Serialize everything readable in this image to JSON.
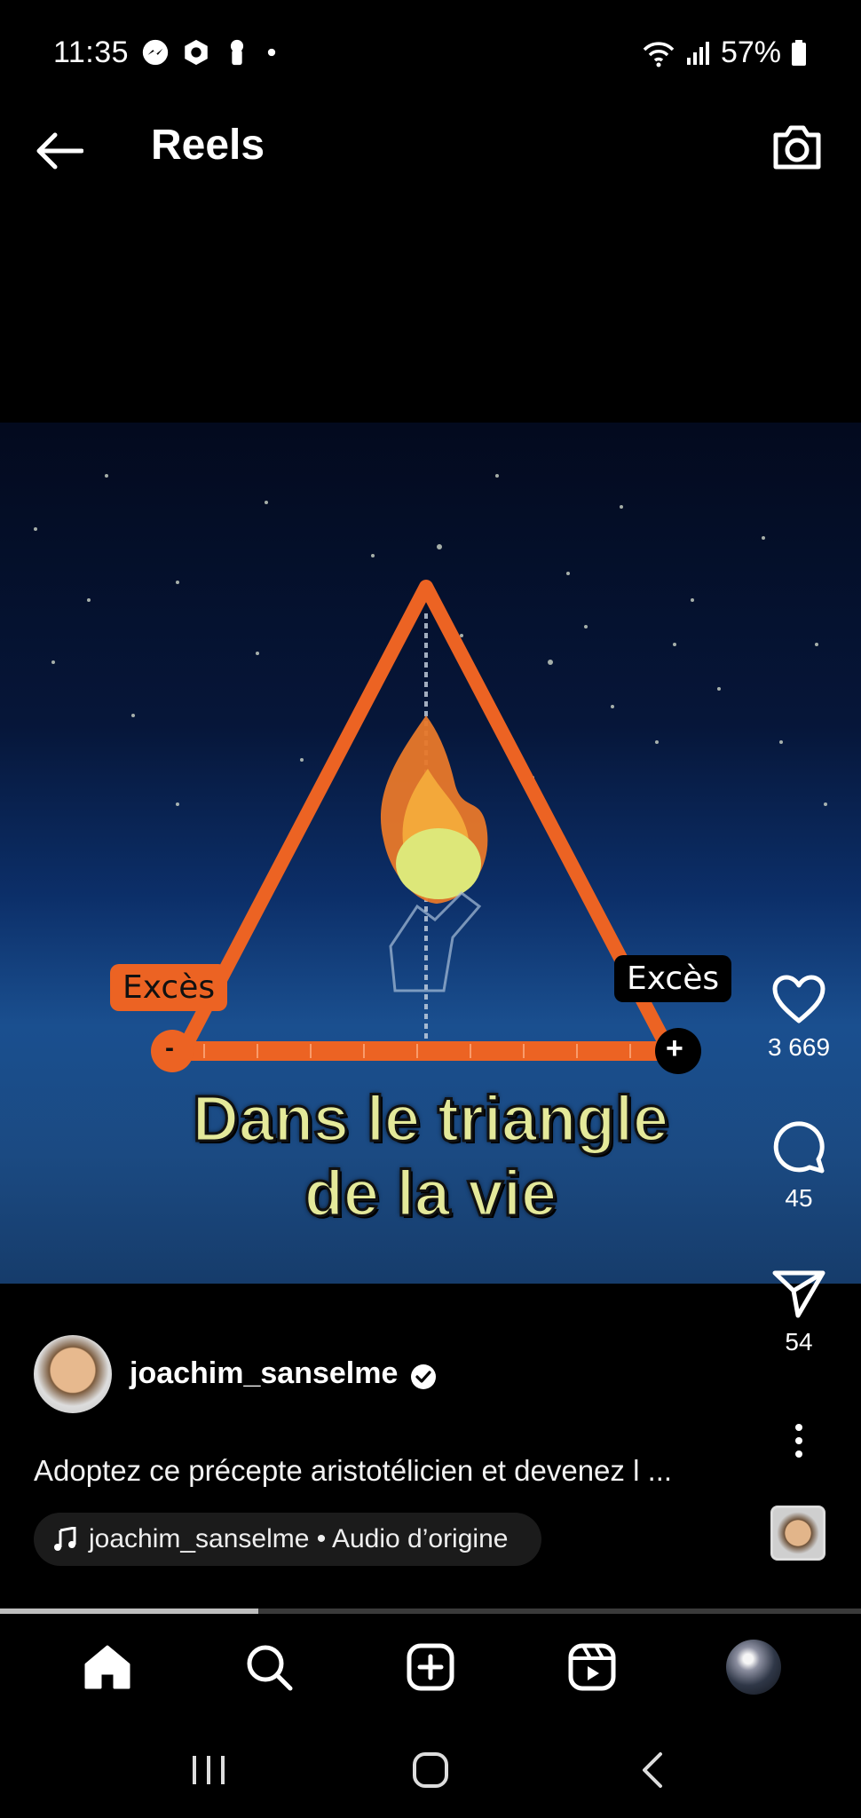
{
  "status_bar": {
    "time": "11:35",
    "battery": "57%",
    "left_icons": [
      "messenger-icon",
      "app-icon",
      "keyhole-icon",
      "dot-icon"
    ],
    "right_icons": [
      "wifi-icon",
      "signal-icon",
      "battery-icon"
    ]
  },
  "header": {
    "title": "Reels",
    "back_icon": "arrow-left-icon",
    "camera_icon": "camera-icon"
  },
  "video": {
    "caption_line1": "Dans le triangle",
    "caption_line2": "de la vie",
    "label_left": "Excès",
    "label_right": "Excès",
    "minus_sign": "-",
    "plus_sign": "+"
  },
  "actions": {
    "likes": "3 669",
    "comments": "45",
    "shares": "54"
  },
  "post": {
    "username": "joachim_sanselme",
    "caption": "Adoptez ce précepte aristotélicien et devenez l ...",
    "audio": "joachim_sanselme • Audio d’origine"
  },
  "progress": {
    "fraction": 0.3
  },
  "bottom_nav": [
    "home-icon",
    "search-icon",
    "create-icon",
    "reels-icon",
    "profile-avatar"
  ],
  "system_nav": [
    "recent-apps-icon",
    "home-circle-icon",
    "back-chevron-icon"
  ]
}
